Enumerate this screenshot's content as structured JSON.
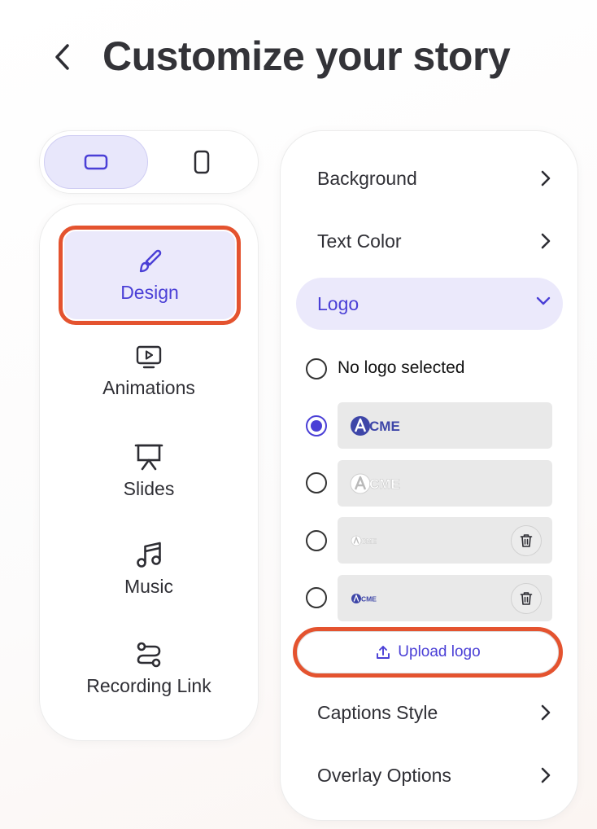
{
  "header": {
    "title": "Customize your story"
  },
  "orientation": {
    "options": [
      {
        "id": "landscape",
        "selected": true
      },
      {
        "id": "portrait",
        "selected": false
      }
    ]
  },
  "nav": {
    "items": [
      {
        "label": "Design",
        "icon": "brush-icon",
        "active": true
      },
      {
        "label": "Animations",
        "icon": "video-play-icon",
        "active": false
      },
      {
        "label": "Slides",
        "icon": "presentation-icon",
        "active": false
      },
      {
        "label": "Music",
        "icon": "music-note-icon",
        "active": false
      },
      {
        "label": "Recording Link",
        "icon": "route-link-icon",
        "active": false
      }
    ]
  },
  "panel": {
    "background_label": "Background",
    "text_color_label": "Text Color",
    "logo_label": "Logo",
    "no_logo_label": "No logo selected",
    "logos": [
      {
        "text": "CME",
        "style": "blue-large",
        "selected": true,
        "deletable": false
      },
      {
        "text": "CME",
        "style": "white-large",
        "selected": false,
        "deletable": false
      },
      {
        "text": "CME",
        "style": "white-small",
        "selected": false,
        "deletable": true
      },
      {
        "text": "CME",
        "style": "blue-small",
        "selected": false,
        "deletable": true
      }
    ],
    "upload_label": "Upload logo",
    "captions_label": "Captions Style",
    "overlay_label": "Overlay Options"
  },
  "colors": {
    "accent": "#4a3fd6",
    "accent_bg": "#ebe9fb",
    "highlight": "#e4532f",
    "text": "#2f2f35"
  }
}
